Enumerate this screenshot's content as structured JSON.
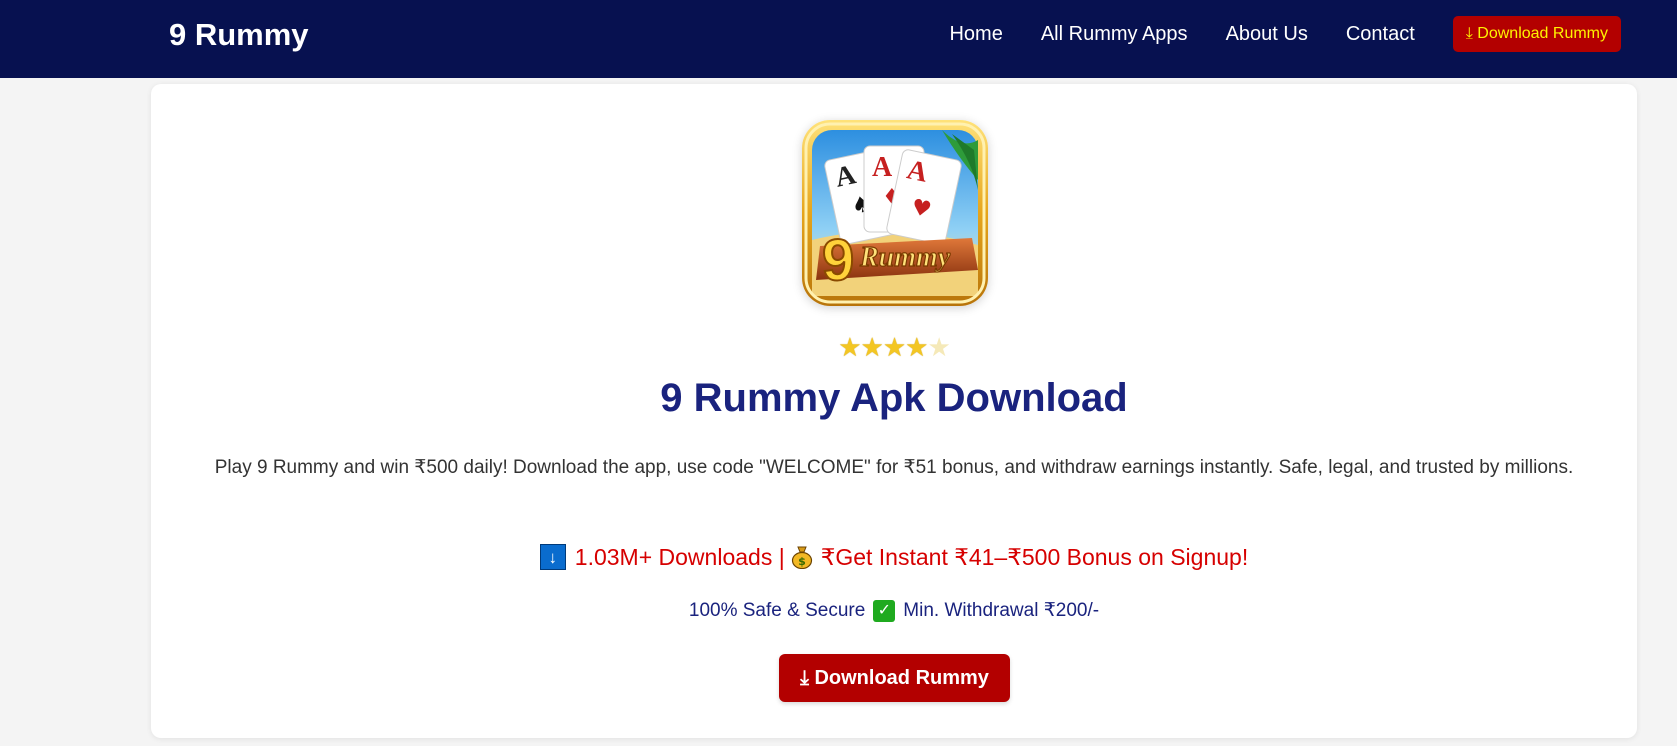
{
  "navbar": {
    "brand": "9 Rummy",
    "links": [
      "Home",
      "All Rummy Apps",
      "About Us",
      "Contact"
    ],
    "download_label": "⤓ Download Rummy"
  },
  "hero": {
    "app_name": "9 Rummy",
    "rating": {
      "value": 4,
      "max": 5
    },
    "title": "9 Rummy Apk Download",
    "description": "Play 9 Rummy and win ₹500 daily! Download the app, use code \"WELCOME\" for ₹51 bonus, and withdraw earnings instantly. Safe, legal, and trusted by millions.",
    "downloads_text": "1.03M+ Downloads |",
    "bonus_text": "₹Get Instant ₹41–₹500 Bonus on Signup!",
    "safe_text": "100% Safe & Secure",
    "withdrawal_text": "Min. Withdrawal ₹200/-",
    "download_button": "⤓ Download Rummy"
  },
  "colors": {
    "navbar_bg": "#071150",
    "accent_red": "#b30000",
    "nav_button_text": "#fff200",
    "title_blue": "#1a237e",
    "highlight_red": "#d60000",
    "check_green": "#1faa1f",
    "down_arrow_blue": "#0a6cce"
  },
  "icons": {
    "downloads": "down-arrow-icon",
    "bonus": "money-bag-icon",
    "safe": "check-mark-icon"
  }
}
